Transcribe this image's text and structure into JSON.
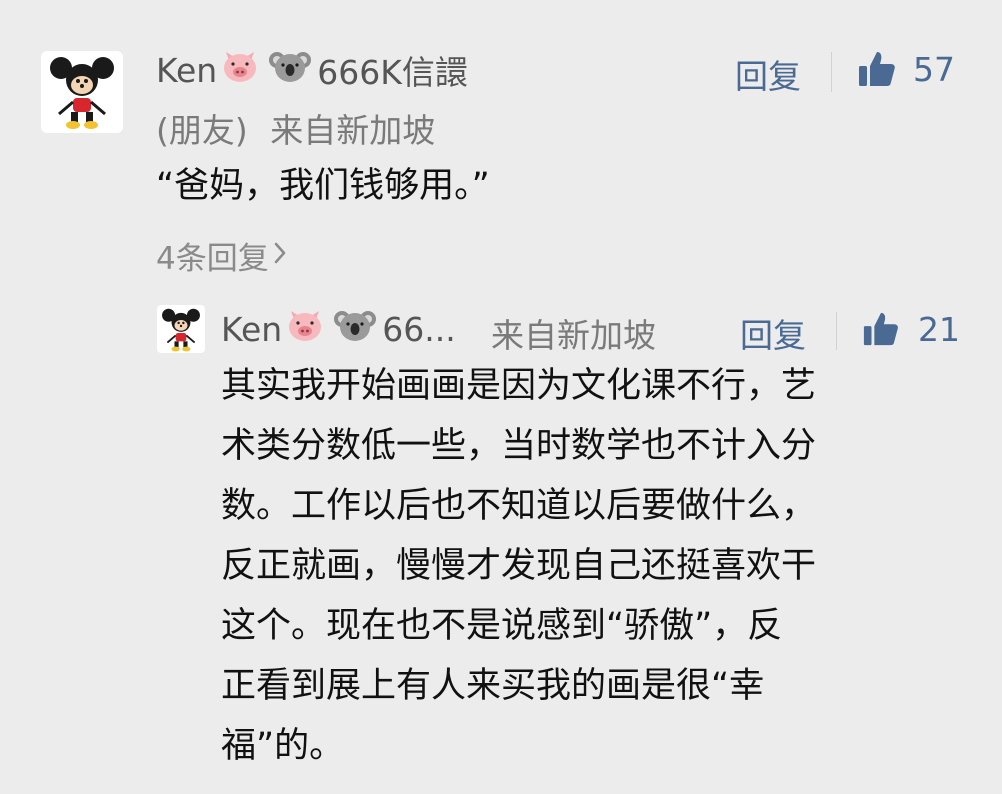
{
  "comment": {
    "username": "Ken",
    "username_suffix": "666K信譞",
    "relation": "(朋友)",
    "location": "来自新加坡",
    "text": "“爸妈，我们钱够用。”",
    "reply_label": "回复",
    "likes": "57",
    "replies_link": "4条回复"
  },
  "reply": {
    "username": "Ken",
    "username_suffix": "66...",
    "location": "来自新加坡",
    "reply_label": "回复",
    "likes": "21",
    "lines": [
      "其实我开始画画是因为文化课不行，艺",
      "术类分数低一些，当时数学也不计入分",
      "数。工作以后也不知道以后要做什么，",
      "反正就画，慢慢才发现自己还挺喜欢干",
      "这个。现在也不是说感到“骄傲”，反",
      "正看到展上有人来买我的画是很“幸",
      "福”的。"
    ]
  },
  "icons": {
    "avatar": "mickey-mouse-avatar",
    "emoji_1": "pig-face-emoji",
    "emoji_2": "koala-emoji",
    "like": "thumbs-up-icon",
    "chevron": "chevron-right-icon"
  },
  "colors": {
    "background": "#ececec",
    "link": "#4a6a93",
    "meta": "#7a7a7a",
    "text": "#111111"
  }
}
